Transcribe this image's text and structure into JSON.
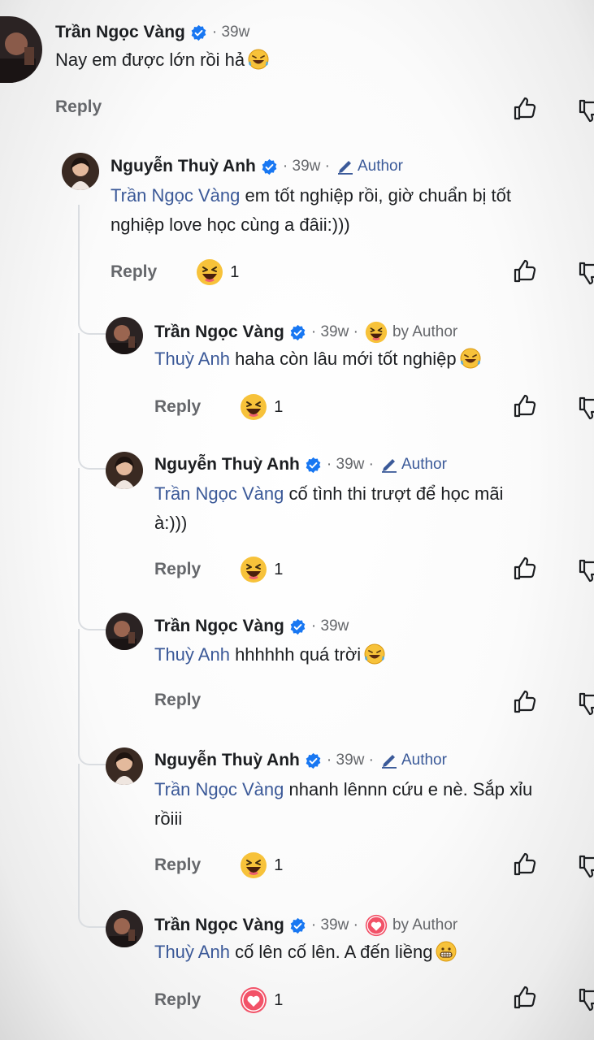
{
  "comments": [
    {
      "author": "Trần Ngọc Vàng",
      "time": "· 39w",
      "text": "Nay em được lớn rồi hả",
      "reply_label": "Reply"
    },
    {
      "author": "Nguyễn Thuỳ Anh",
      "time": "· 39w ·",
      "badge": "Author",
      "mention": "Trần Ngọc Vàng",
      "text_line1": " em tốt nghiệp rồi, giờ chuẩn bị tốt",
      "text_line2": "nghiệp love học cùng a đâii:)))",
      "reply_label": "Reply",
      "reaction_count": "1"
    },
    {
      "author": "Trần Ngọc Vàng",
      "time": "· 39w ·",
      "by_author": "by Author",
      "mention": "Thuỳ Anh",
      "text": " haha còn lâu mới tốt nghiệp",
      "reply_label": "Reply",
      "reaction_count": "1"
    },
    {
      "author": "Nguyễn Thuỳ Anh",
      "time": "· 39w ·",
      "badge": "Author",
      "mention": "Trần Ngọc Vàng",
      "text_line1": " cố tình thi trượt để học mãi",
      "text_line2": "à:)))",
      "reply_label": "Reply",
      "reaction_count": "1"
    },
    {
      "author": "Trần Ngọc Vàng",
      "time": "· 39w",
      "mention": "Thuỳ Anh",
      "text": " hhhhhh quá trời",
      "reply_label": "Reply"
    },
    {
      "author": "Nguyễn Thuỳ Anh",
      "time": "· 39w ·",
      "badge": "Author",
      "mention": "Trần Ngọc Vàng",
      "text_line1": " nhanh lênnn cứu e nè. Sắp xỉu",
      "text_line2": "rồiii",
      "reply_label": "Reply",
      "reaction_count": "1"
    },
    {
      "author": "Trần Ngọc Vàng",
      "time": "· 39w ·",
      "by_author": "by Author",
      "mention": "Thuỳ Anh",
      "text": " cố lên cố lên. A đến liềng",
      "reply_label": "Reply",
      "reaction_count": "1"
    }
  ],
  "icons": {
    "verified": "verified-badge-icon",
    "author": "pencil-icon",
    "like": "thumbs-up-icon",
    "dislike": "thumbs-down-icon",
    "haha": "haha-reaction-icon",
    "love": "love-reaction-icon",
    "rofl": "rolling-laughing-emoji",
    "grimace": "grimacing-emoji"
  },
  "colors": {
    "mention": "#3b5998",
    "author_badge": "#3b5a99",
    "muted": "#65676b",
    "verified": "#1877f2"
  }
}
